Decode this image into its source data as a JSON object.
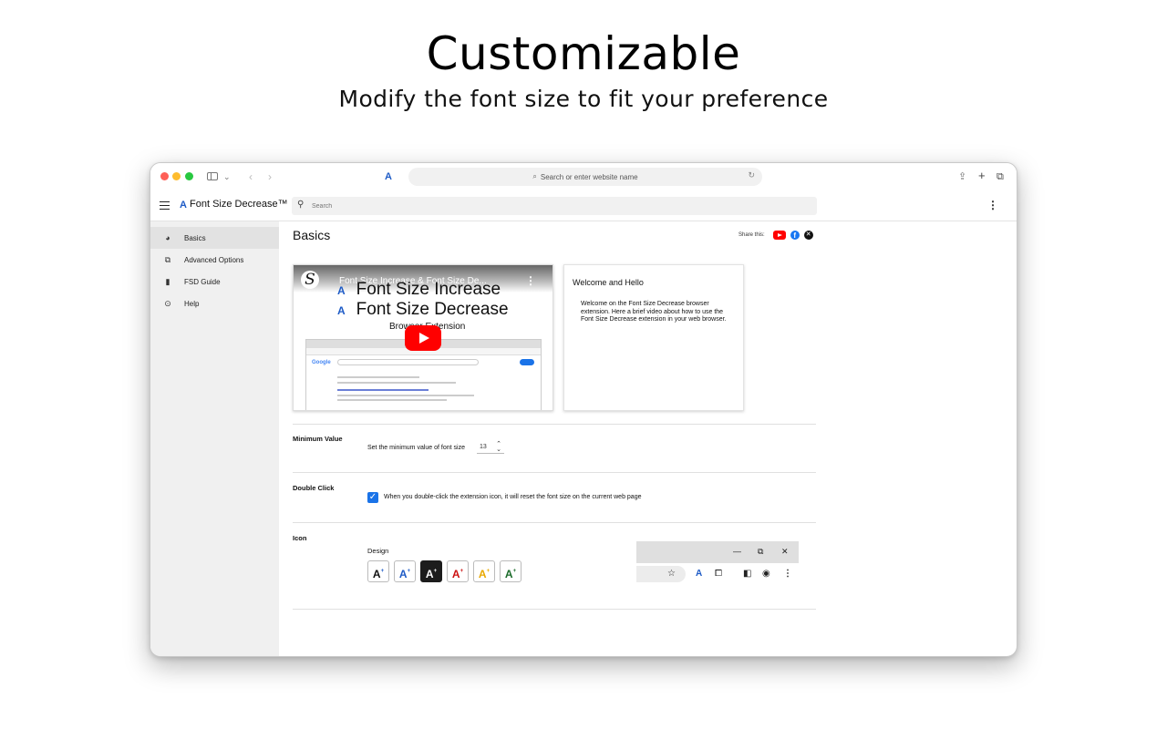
{
  "hero": {
    "title": "Customizable",
    "subtitle": "Modify the font size to fit your preference"
  },
  "browser": {
    "address_placeholder": "Search or enter website name",
    "extension_icon_letter": "A"
  },
  "app": {
    "name": "Font Size Decrease™",
    "logo_letter": "A",
    "search_placeholder": "Search"
  },
  "sidebar": {
    "items": [
      {
        "label": "Basics",
        "icon": "palette-icon",
        "active": true
      },
      {
        "label": "Advanced Options",
        "icon": "shapes-icon",
        "active": false
      },
      {
        "label": "FSD Guide",
        "icon": "bookmark-icon",
        "active": false
      },
      {
        "label": "Help",
        "icon": "help-circle-icon",
        "active": false
      }
    ]
  },
  "main": {
    "title": "Basics",
    "share_label": "Share this:",
    "share_icons": [
      "youtube-icon",
      "facebook-icon",
      "x-icon"
    ],
    "video": {
      "channel_letter": "S",
      "title": "Font Size Increase & Font Size De...",
      "line1": "Font Size Increase",
      "line2": "Font Size Decrease",
      "subtitle": "Browser Extension",
      "search_logo": "Google"
    },
    "welcome": {
      "title": "Welcome and Hello",
      "text": "Welcome on the Font Size Decrease browser extension. Here a brief video about how to use the Font Size Decrease extension in your web browser."
    },
    "minimum": {
      "label": "Minimum Value",
      "text": "Set the minimum value of font size",
      "value": "13"
    },
    "double_click": {
      "label": "Double Click",
      "checked": true,
      "text": "When you double-click the extension icon, it will reset the font size on the current web page"
    },
    "icon": {
      "label": "Icon",
      "design_label": "Design",
      "designs": [
        {
          "letter": "A",
          "bg": "#ffffff",
          "fg": "#111111"
        },
        {
          "letter": "A",
          "bg": "#ffffff",
          "fg": "#1e5bc6"
        },
        {
          "letter": "A",
          "bg": "#1c1c1c",
          "fg": "#ffffff"
        },
        {
          "letter": "A",
          "bg": "#ffffff",
          "fg": "#cc1111"
        },
        {
          "letter": "A",
          "bg": "#ffffff",
          "fg": "#e8a800"
        },
        {
          "letter": "A",
          "bg": "#ffffff",
          "fg": "#1a6b2a"
        }
      ]
    }
  },
  "colors": {
    "accent": "#1a73e8",
    "brand_blue": "#1e5bc6",
    "youtube_red": "#ff0000",
    "facebook_blue": "#1877f2"
  }
}
